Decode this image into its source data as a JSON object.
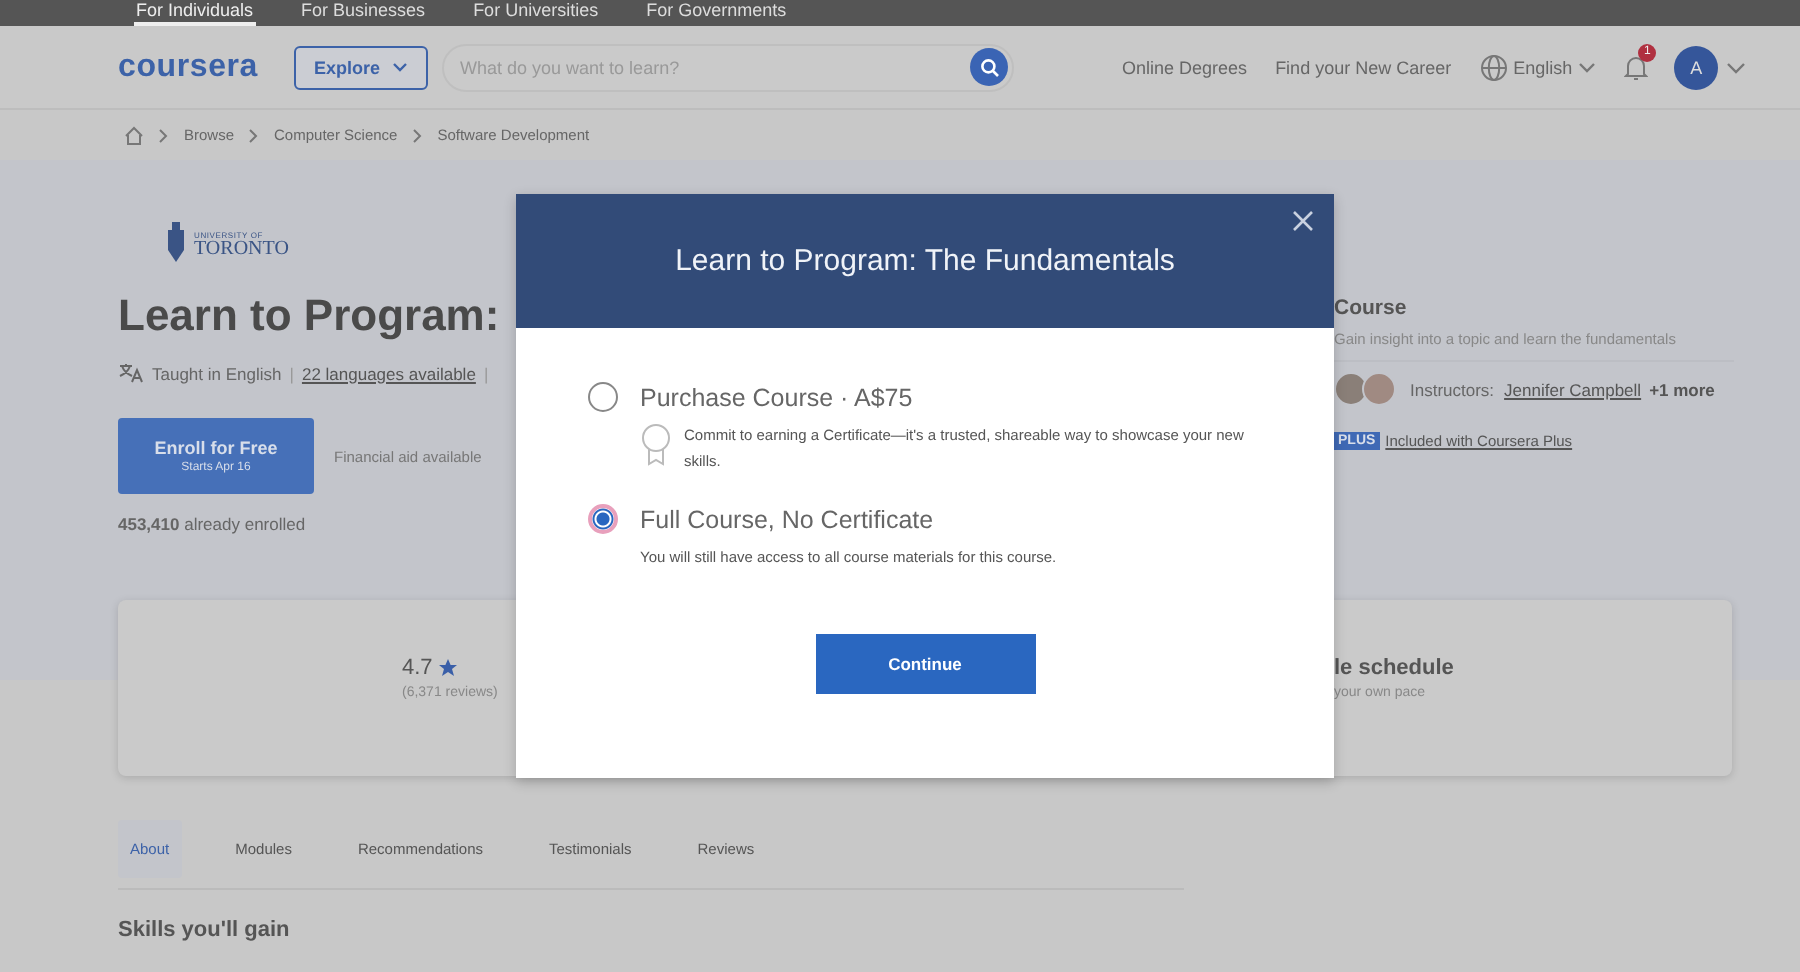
{
  "top_nav": [
    {
      "label": "For Individuals",
      "selected": true
    },
    {
      "label": "For Businesses",
      "selected": false
    },
    {
      "label": "For Universities",
      "selected": false
    },
    {
      "label": "For Governments",
      "selected": false
    }
  ],
  "header": {
    "logo": "coursera",
    "explore_button": "Explore",
    "search": {
      "placeholder": "What do you want to learn?"
    },
    "links": [
      "Online Degrees",
      "Find your New Career"
    ],
    "language": "English",
    "notification_count": "1",
    "avatar_letter": "A"
  },
  "breadcrumb": [
    "Browse",
    "Computer Science",
    "Software Development"
  ],
  "course": {
    "university_line_1": "UNIVERSITY OF",
    "university_line_2": "TORONTO",
    "title": "Learn to Program:",
    "taught_in": "Taught in English",
    "languages_link": "22 languages available",
    "separator": "|",
    "enroll_button": {
      "label": "Enroll for Free",
      "sublabel": "Starts Apr 16"
    },
    "financial_aid": "Financial aid available",
    "enrolled": "**453,410** already enrolled"
  },
  "side": {
    "type": "Course",
    "description": "Gain insight into a topic and learn the fundamentals",
    "instructors_label": "Instructors:",
    "instructor_link": "Jennifer Campbell",
    "more": "+1 more",
    "plus_badge": "PLUS",
    "plus_link": "Included with Coursera Plus"
  },
  "stats": {
    "rating": "4.7",
    "reviews": "(6,371 reviews)",
    "schedule_title": "le schedule",
    "schedule_sub": "your own pace"
  },
  "tabs": [
    {
      "label": "About",
      "selected": true
    },
    {
      "label": "Modules",
      "selected": false
    },
    {
      "label": "Recommendations",
      "selected": false
    },
    {
      "label": "Testimonials",
      "selected": false
    },
    {
      "label": "Reviews",
      "selected": false
    }
  ],
  "section_heading": "Skills you'll gain",
  "modal": {
    "title": "Learn to Program: The Fundamentals",
    "options": [
      {
        "kind": "certificate",
        "label": "Purchase Course · A$75",
        "description": "Commit to earning a Certificate—it's a trusted, shareable way to showcase your new skills.",
        "selected": false
      },
      {
        "kind": "plain",
        "label": "Full Course, No Certificate",
        "description": "You will still have access to all course materials for this course.",
        "selected": true
      }
    ],
    "continue_button": "Continue"
  }
}
